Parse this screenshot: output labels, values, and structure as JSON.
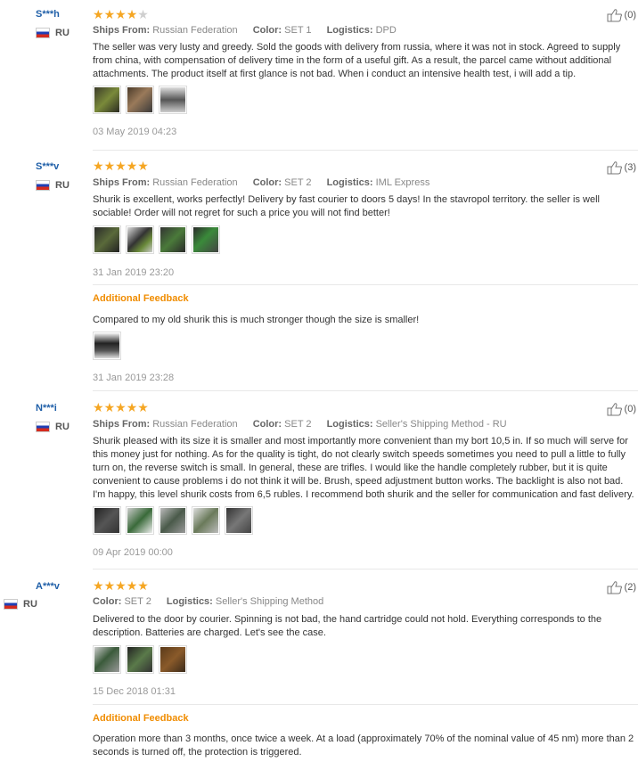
{
  "reviews": [
    {
      "user": "S***h",
      "country": "RU",
      "stars": 4,
      "ships_from_label": "Ships From:",
      "ships_from": "Russian Federation",
      "color_label": "Color:",
      "color": "SET 1",
      "logistics_label": "Logistics:",
      "logistics": "DPD",
      "likes": "(0)",
      "text": "The seller was very lusty and greedy. Sold the goods with delivery from russia, where it was not in stock. Agreed to supply from china, with compensation of delivery time in the form of a useful gift. As a result, the parcel came without additional attachments. The product itself at first glance is not bad. When i conduct an intensive health test, i will add a tip.",
      "date": "03 May 2019 04:23"
    },
    {
      "user": "S***v",
      "country": "RU",
      "stars": 5,
      "ships_from_label": "Ships From:",
      "ships_from": "Russian Federation",
      "color_label": "Color:",
      "color": "SET 2",
      "logistics_label": "Logistics:",
      "logistics": "IML Express",
      "likes": "(3)",
      "text": "Shurik is excellent, works perfectly! Delivery by fast courier to doors 5 days! In the stavropol territory. the seller is well sociable! Order will not regret for such a price you will not find better!",
      "date": "31 Jan 2019 23:20",
      "additional_label": "Additional Feedback",
      "additional_text": "Compared to my old shurik this is much stronger though the size is smaller!",
      "additional_date": "31 Jan 2019 23:28"
    },
    {
      "user": "N***i",
      "country": "RU",
      "stars": 5,
      "ships_from_label": "Ships From:",
      "ships_from": "Russian Federation",
      "color_label": "Color:",
      "color": "SET 2",
      "logistics_label": "Logistics:",
      "logistics": "Seller's Shipping Method - RU",
      "likes": "(0)",
      "text": "Shurik pleased with its size it is smaller and most importantly more convenient than my bort 10,5 in. If so much will serve for this money just for nothing. As for the quality is tight, do not clearly switch speeds sometimes you need to pull a little to fully turn on, the reverse switch is small. In general, these are trifles. I would like the handle completely rubber, but it is quite convenient to cause problems i do not think it will be. Brush, speed adjustment button works. The backlight is also not bad. I'm happy, this level shurik costs from 6,5 rubles. I recommend both shurik and the seller for communication and fast delivery.",
      "date": "09 Apr 2019 00:00"
    },
    {
      "user": "A***v",
      "country": "RU",
      "stars": 5,
      "color_label": "Color:",
      "color": "SET 2",
      "logistics_label": "Logistics:",
      "logistics": "Seller's Shipping Method",
      "likes": "(2)",
      "text": "Delivered to the door by courier. Spinning is not bad, the hand cartridge could not hold. Everything corresponds to the description. Batteries are charged. Let's see the case.",
      "date": "15 Dec 2018 01:31",
      "additional_label": "Additional Feedback",
      "additional_text": "Operation more than 3 months, once twice a week. At a load (approximately 70% of the nominal value of 45 nm) more than 2 seconds is turned off, the protection is triggered."
    }
  ]
}
